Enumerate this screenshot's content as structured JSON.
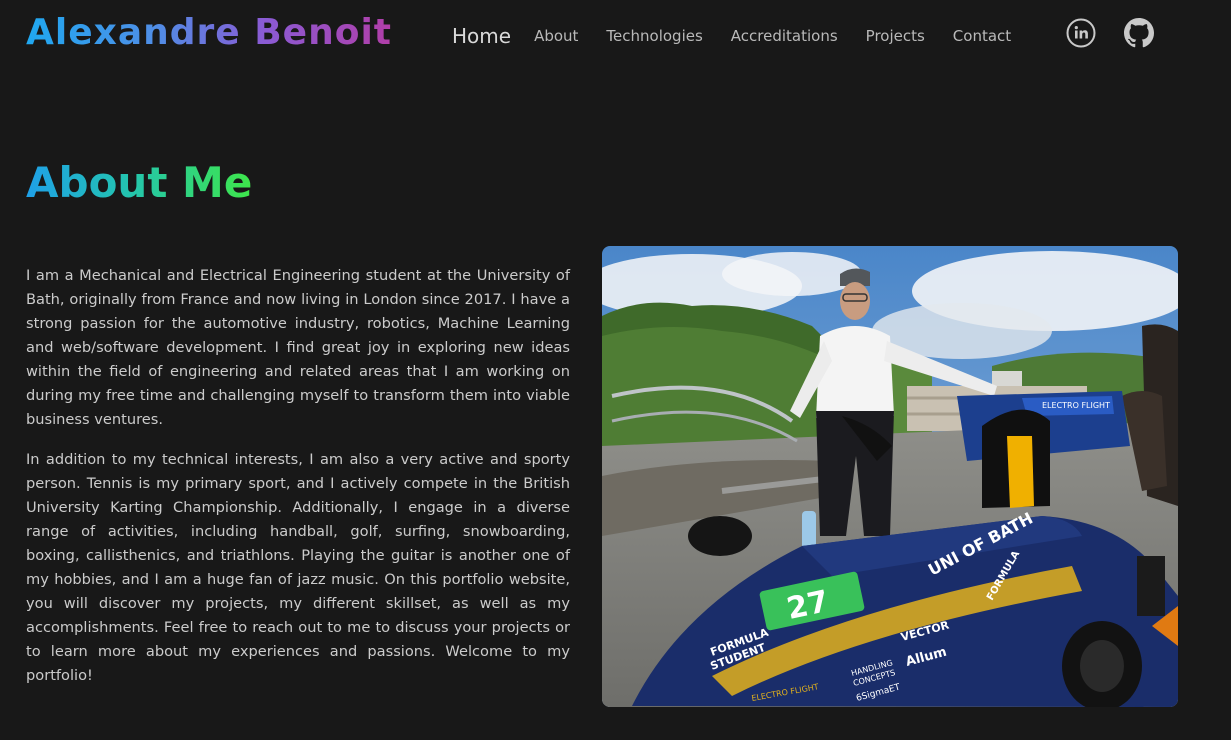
{
  "header": {
    "brand": "Alexandre Benoit",
    "nav": [
      {
        "label": "Home"
      },
      {
        "label": "About"
      },
      {
        "label": "Technologies"
      },
      {
        "label": "Accreditations"
      },
      {
        "label": "Projects"
      },
      {
        "label": "Contact"
      }
    ],
    "social": [
      {
        "icon": "linkedin-icon"
      },
      {
        "icon": "github-icon"
      }
    ]
  },
  "about": {
    "title": "About Me",
    "paragraphs": [
      "I am a Mechanical and Electrical Engineering student at the University of Bath, originally from France and now living in London since 2017. I have a strong passion for the automotive industry, robotics, Machine Learning and web/software development. I find great joy in exploring new ideas within the field of engineering and related areas that I am working on during my free time and challenging myself to transform them into viable business ventures.",
      "In addition to my technical interests, I am also a very active and sporty person. Tennis is my primary sport, and I actively compete in the British University Karting Championship. Additionally, I engage in a diverse range of activities, including handball, golf, surfing, snowboarding, boxing, callisthenics, and triathlons. Playing the guitar is another one of my hobbies, and I am a huge fan of jazz music. On this portfolio website, you will discover my projects, my different skillset, as well as my accomplishments. Feel free to reach out to me to discuss your projects or to learn more about my experiences and passions. Welcome to my portfolio!"
    ],
    "photo": {
      "car_text": {
        "brand": "UNI OF BATH",
        "number": "27",
        "formula": "FORMULA",
        "student": "STUDENT",
        "electro": "ELECTRO FLIGHT",
        "vector": "VECTOR",
        "allum": "Allum",
        "handling": "HANDLING",
        "concepts": "CONCEPTS",
        "sigma": "6SigmaET"
      }
    }
  }
}
